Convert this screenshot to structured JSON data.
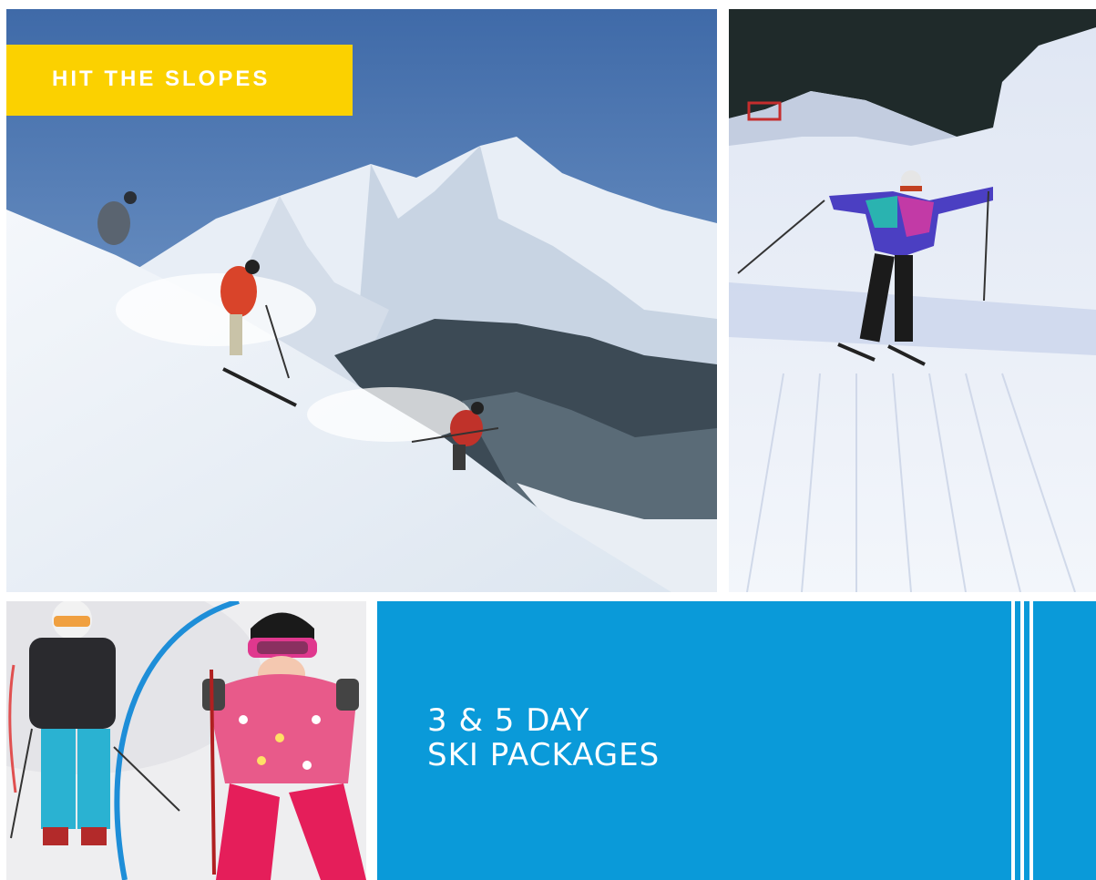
{
  "badge": {
    "text": "HIT THE SLOPES",
    "color": "#fbd100"
  },
  "banner": {
    "line1": "3 & 5 DAY",
    "line2": "SKI PACKAGES",
    "color": "#0a9ad9"
  },
  "photos": [
    {
      "name": "mountain-skiers-photo",
      "subject": "three skiers descending steep powder slope before snowy mountain peak"
    },
    {
      "name": "groomed-slope-skier-photo",
      "subject": "skier in purple and teal jacket with arms outstretched on groomed piste"
    },
    {
      "name": "kids-skiing-photo",
      "subject": "two children in ski helmets and goggles on snow with blue hoop"
    }
  ]
}
